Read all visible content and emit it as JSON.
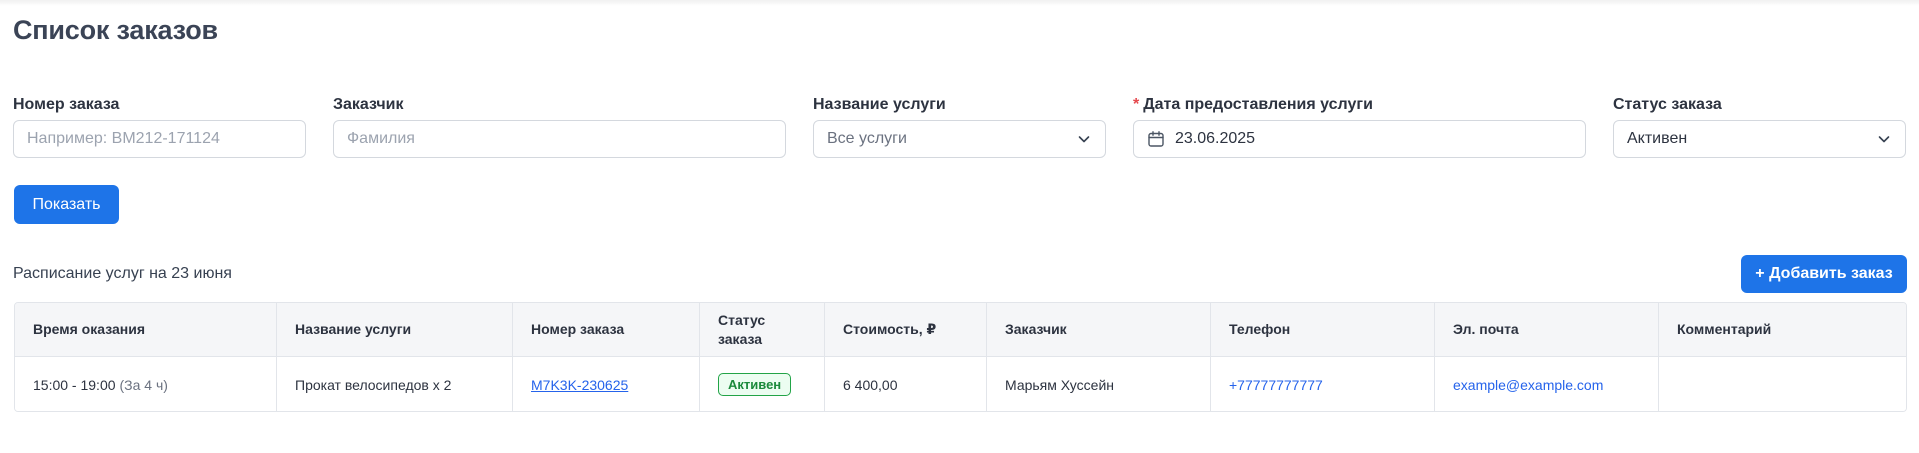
{
  "page": {
    "title": "Список заказов"
  },
  "filters": {
    "order_number": {
      "label": "Номер заказа",
      "placeholder": "Например: ВМ212-171124"
    },
    "customer": {
      "label": "Заказчик",
      "placeholder": "Фамилия"
    },
    "service": {
      "label": "Название услуги",
      "value": "Все услуги"
    },
    "date": {
      "label": "Дата предоставления услуги",
      "required_mark": "*",
      "value": "23.06.2025"
    },
    "status": {
      "label": "Статус заказа",
      "value": "Активен"
    },
    "show_button": "Показать"
  },
  "schedule": {
    "title": "Расписание услуг на 23 июня",
    "add_button": "+ Добавить заказ"
  },
  "table": {
    "headers": {
      "time": "Время оказания",
      "service": "Название услуги",
      "order": "Номер заказа",
      "status_1": "Статус",
      "status_2": "заказа",
      "price": "Стоимость, ₽",
      "customer": "Заказчик",
      "phone": "Телефон",
      "email": "Эл. почта",
      "comment": "Комментарий"
    },
    "rows": [
      {
        "time": "15:00 - 19:00",
        "time_hint": "(За 4 ч)",
        "service": "Прокат велосипедов х 2",
        "order": "M7K3K-230625",
        "status": "Активен",
        "price": "6 400,00",
        "customer": "Марьям Хуссейн",
        "phone": "+77777777777",
        "email": "example@example.com",
        "comment": ""
      }
    ]
  },
  "colors": {
    "primary": "#1e74e8",
    "status_active": "#22a447",
    "link": "#2563eb"
  },
  "icons": {
    "calendar": "calendar-icon",
    "chevron": "chevron-down-icon"
  }
}
